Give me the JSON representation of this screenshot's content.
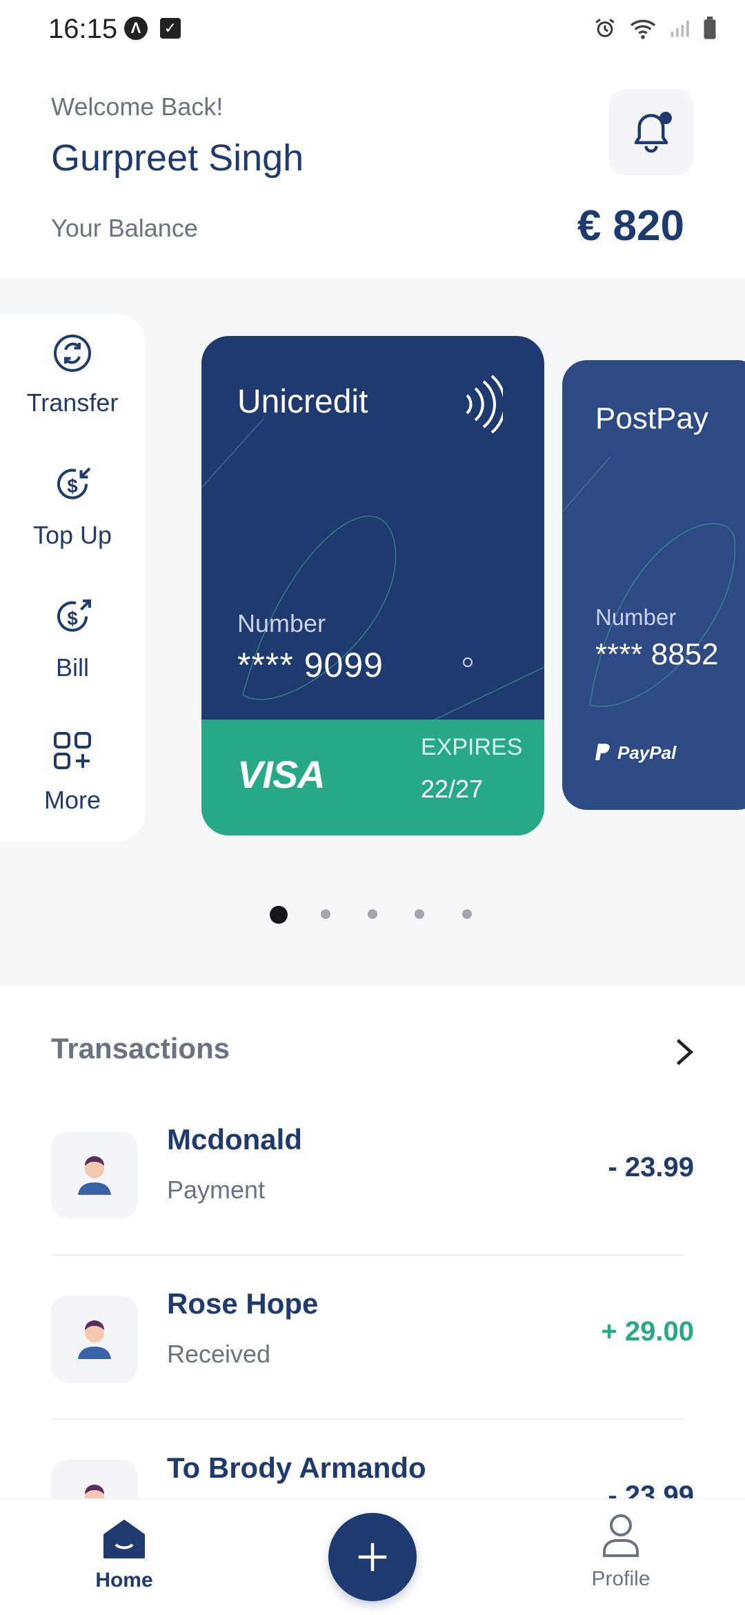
{
  "status_bar": {
    "time": "16:15"
  },
  "header": {
    "welcome": "Welcome Back!",
    "user_name": "Gurpreet Singh",
    "balance_label": "Your Balance",
    "balance_value": "€ 820"
  },
  "actions": [
    {
      "label": "Transfer",
      "icon": "transfer-icon"
    },
    {
      "label": "Top Up",
      "icon": "top-up-icon"
    },
    {
      "label": "Bill",
      "icon": "bill-icon"
    },
    {
      "label": "More",
      "icon": "more-grid-icon"
    }
  ],
  "cards": [
    {
      "bank": "Unicredit",
      "number_label": "Number",
      "number": "**** 9099",
      "brand": "VISA",
      "expires_label": "EXPIRES",
      "expires": "22/27"
    },
    {
      "bank": "PostPay",
      "number_label": "Number",
      "number": "**** 8852",
      "brand": "PayPal"
    }
  ],
  "pager": {
    "count": 5,
    "active": 0
  },
  "transactions": {
    "title": "Transactions",
    "items": [
      {
        "name": "Mcdonald",
        "type": "Payment",
        "amount": "- 23.99",
        "color": "#1e3a6e"
      },
      {
        "name": "Rose Hope",
        "type": "Received",
        "amount": "+ 29.00",
        "color": "#27a987"
      },
      {
        "name": "To Brody Armando",
        "type": "",
        "amount": "- 23.99",
        "color": "#1e3a6e"
      }
    ]
  },
  "bottom_nav": {
    "home": "Home",
    "profile": "Profile"
  },
  "colors": {
    "primary": "#1e3a6e",
    "accent": "#27a987"
  }
}
